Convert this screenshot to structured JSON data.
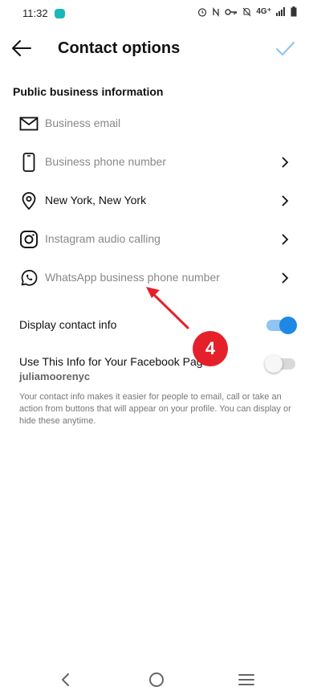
{
  "status_bar": {
    "time": "11:32",
    "network": "4G⁺"
  },
  "header": {
    "title": "Contact options"
  },
  "section": {
    "heading": "Public business information"
  },
  "options": [
    {
      "label": "Business email",
      "icon": "mail-icon",
      "has_chevron": false
    },
    {
      "label": "Business phone number",
      "icon": "phone-icon",
      "has_chevron": true
    },
    {
      "label": "New York, New York",
      "icon": "location-pin-icon",
      "has_chevron": true
    },
    {
      "label": "Instagram audio calling",
      "icon": "instagram-icon",
      "has_chevron": true
    },
    {
      "label": "WhatsApp business phone number",
      "icon": "whatsapp-icon",
      "has_chevron": true
    }
  ],
  "display_contact": {
    "label": "Display contact info",
    "on": true
  },
  "facebook_page": {
    "label": "Use This Info for Your Facebook Page",
    "username": "juliamoorenyc",
    "on": false
  },
  "footnote": "Your contact info makes it easier for people to email, call or take an action from buttons that will appear on your profile. You can display or hide these anytime.",
  "annotation": {
    "badge": "4",
    "color": "#e5202a"
  },
  "colors": {
    "accent": "#1e88e5",
    "check": "#8fc4f4"
  }
}
